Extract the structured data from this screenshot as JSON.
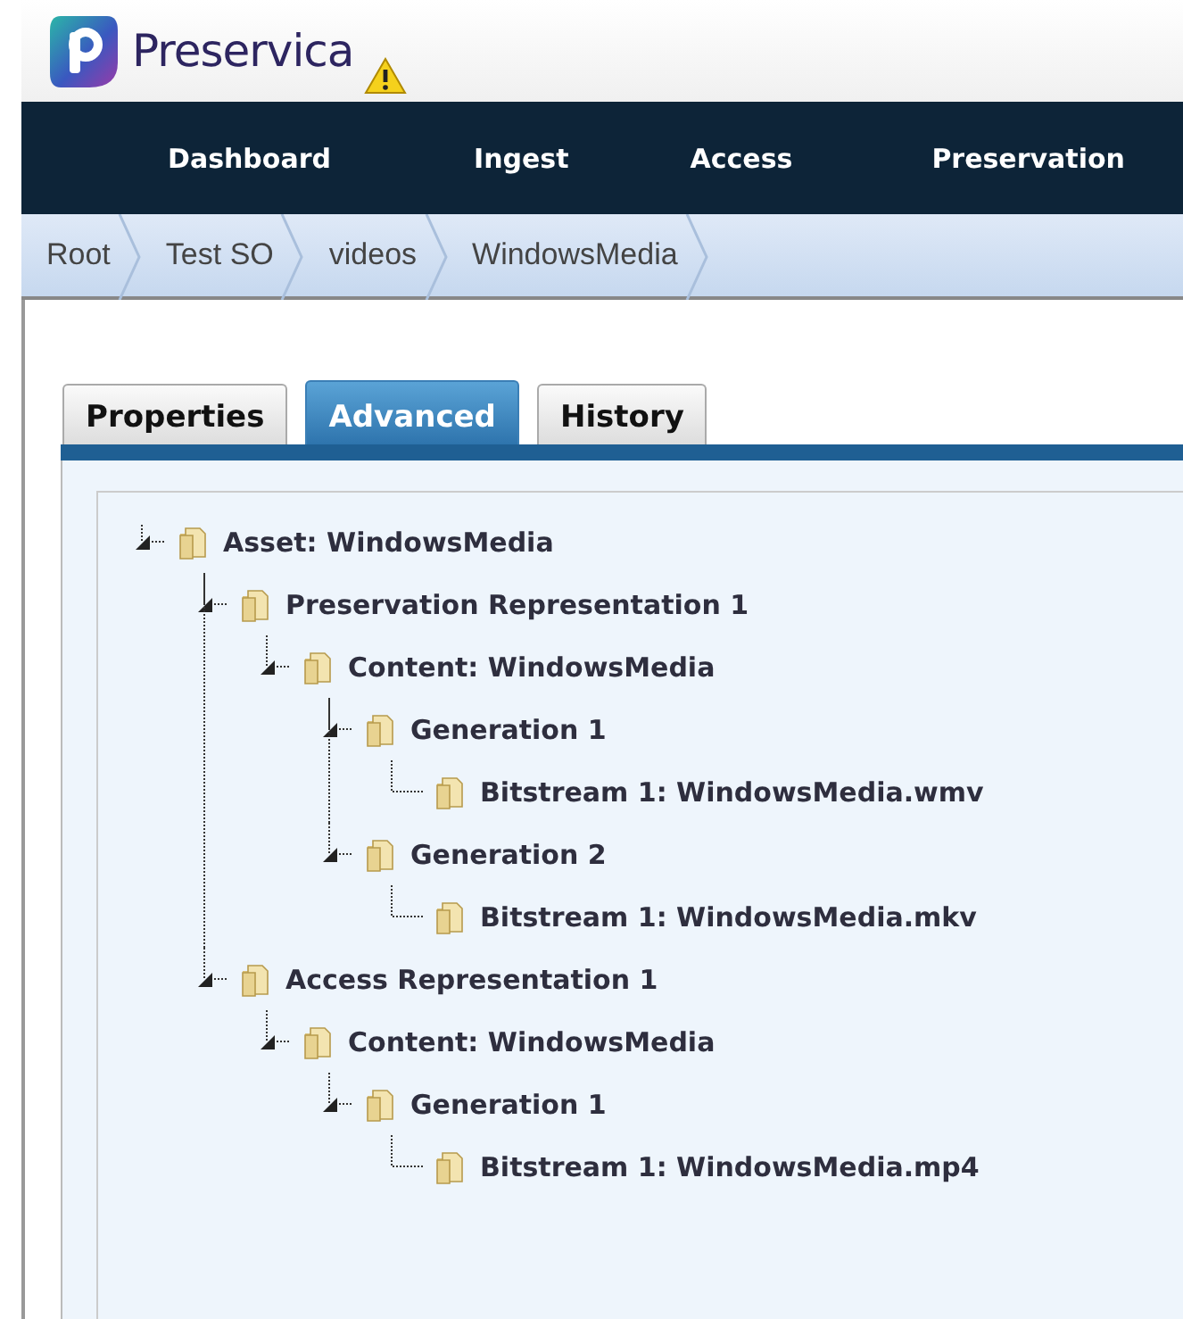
{
  "header": {
    "brand": "Preservica"
  },
  "nav": [
    {
      "label": "Dashboard"
    },
    {
      "label": "Ingest"
    },
    {
      "label": "Access"
    },
    {
      "label": "Preservation"
    }
  ],
  "breadcrumb": [
    {
      "label": "Root"
    },
    {
      "label": "Test SO"
    },
    {
      "label": "videos"
    },
    {
      "label": "WindowsMedia"
    }
  ],
  "tabs": [
    {
      "label": "Properties",
      "selected": false
    },
    {
      "label": "Advanced",
      "selected": true
    },
    {
      "label": "History",
      "selected": false
    }
  ],
  "tree": [
    {
      "label": "Asset: WindowsMedia",
      "children": [
        {
          "label": "Preservation Representation 1",
          "children": [
            {
              "label": "Content: WindowsMedia",
              "children": [
                {
                  "label": "Generation 1",
                  "children": [
                    {
                      "label": "Bitstream 1: WindowsMedia.wmv"
                    }
                  ]
                },
                {
                  "label": "Generation 2",
                  "children": [
                    {
                      "label": "Bitstream 1: WindowsMedia.mkv"
                    }
                  ]
                }
              ]
            }
          ]
        },
        {
          "label": "Access Representation 1",
          "children": [
            {
              "label": "Content: WindowsMedia",
              "children": [
                {
                  "label": "Generation 1",
                  "children": [
                    {
                      "label": "Bitstream 1: WindowsMedia.mp4"
                    }
                  ]
                }
              ]
            }
          ]
        }
      ]
    }
  ]
}
